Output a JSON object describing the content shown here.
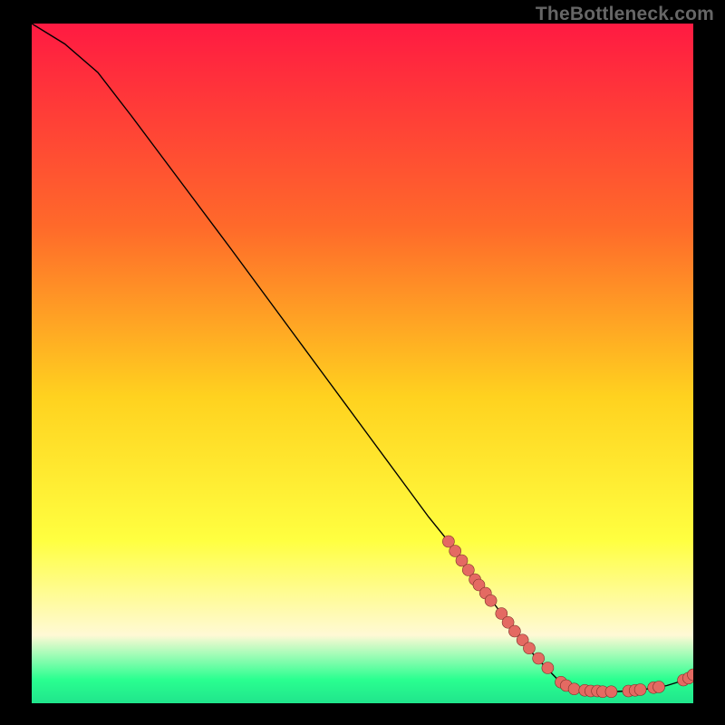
{
  "watermark": "TheBottleneck.com",
  "colors": {
    "bg_black": "#000000",
    "grad_top": "#ff1a42",
    "grad_mid1": "#ff6a2a",
    "grad_mid2": "#ffd21f",
    "grad_mid3": "#ffff40",
    "grad_low1": "#fff9d5",
    "grad_low2": "#2aff90",
    "grad_bottom": "#20e58c",
    "curve": "#000000",
    "marker_fill": "#e46a62",
    "marker_stroke": "#7a2f27",
    "watermark": "#666666"
  },
  "chart_data": {
    "type": "line",
    "title": "",
    "xlabel": "",
    "ylabel": "",
    "xlim": [
      0,
      100
    ],
    "ylim": [
      0,
      100
    ],
    "grid": false,
    "legend": false,
    "series": [
      {
        "name": "curve",
        "x": [
          0,
          5,
          10,
          15,
          20,
          25,
          30,
          35,
          40,
          45,
          50,
          55,
          60,
          63,
          65,
          68,
          70,
          73,
          76,
          80,
          82,
          84,
          86,
          88,
          90,
          92,
          94,
          96,
          98,
          100
        ],
        "y": [
          100,
          97,
          92.8,
          86.5,
          80,
          73.5,
          67,
          60.4,
          53.8,
          47.2,
          40.6,
          34,
          27.4,
          23.8,
          21,
          17.2,
          14.5,
          10.6,
          7,
          3,
          2,
          1.8,
          1.7,
          1.7,
          1.8,
          2,
          2.2,
          2.6,
          3.2,
          4.2
        ]
      }
    ],
    "markers": {
      "name": "cluster",
      "x": [
        63.0,
        64.0,
        65.0,
        66.0,
        67.0,
        67.6,
        68.6,
        69.4,
        71.0,
        72.0,
        73.0,
        74.2,
        75.2,
        76.6,
        78.0,
        80.0,
        80.8,
        82.0,
        83.6,
        84.5,
        85.5,
        86.3,
        87.6,
        90.2,
        91.2,
        92.0,
        94.0,
        94.8,
        98.5,
        99.3,
        100.0
      ],
      "y": [
        23.8,
        22.4,
        21.0,
        19.6,
        18.2,
        17.4,
        16.2,
        15.1,
        13.2,
        11.9,
        10.6,
        9.3,
        8.1,
        6.6,
        5.2,
        3.1,
        2.6,
        2.1,
        1.9,
        1.8,
        1.8,
        1.7,
        1.7,
        1.8,
        1.9,
        2.0,
        2.3,
        2.4,
        3.4,
        3.7,
        4.2
      ]
    },
    "background_gradient": {
      "direction": "vertical",
      "stops": [
        {
          "offset": 0.0,
          "color": "#ff1a42"
        },
        {
          "offset": 0.3,
          "color": "#ff6a2a"
        },
        {
          "offset": 0.55,
          "color": "#ffd21f"
        },
        {
          "offset": 0.76,
          "color": "#ffff40"
        },
        {
          "offset": 0.9,
          "color": "#fff9d5"
        },
        {
          "offset": 0.965,
          "color": "#2aff90"
        },
        {
          "offset": 1.0,
          "color": "#20e58c"
        }
      ]
    }
  }
}
